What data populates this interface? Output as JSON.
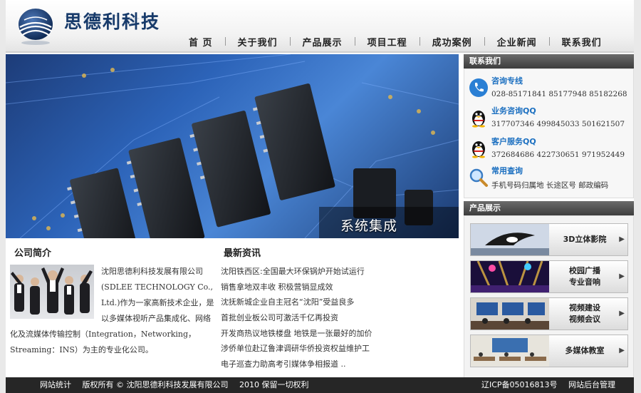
{
  "header": {
    "brand": "思德利科技",
    "nav": [
      "首 页",
      "关于我们",
      "产品展示",
      "项目工程",
      "成功案例",
      "企业新闻",
      "联系我们"
    ]
  },
  "banner": {
    "caption": "系统集成"
  },
  "intro": {
    "title": "公司简介",
    "text": "沈阳思德利科技发展有限公司(SDLEE TECHNOLOGY Co., Ltd.)作为一家高新技术企业，是以多媒体视听产品集成化、网络化及流媒体传输控制（Integration，Networking，Streaming：INS）为主的专业化公司。"
  },
  "news": {
    "title": "最新资讯",
    "items": [
      "沈阳铁西区:全国最大环保锅炉开始试运行",
      "销售拿地双丰收 积极营销显成效",
      "沈抚新城企业自主冠名“沈阳”受益良多",
      "首批创业板公司可激活千亿再投资",
      "开发商热议地铁楼盘 地铁是一张最好的加价",
      "涉侨单位赴辽鲁津调研华侨投资权益维护工",
      "电子巡查力助高考引媒体争相报道 .."
    ]
  },
  "contact": {
    "head": "联系我们",
    "items": [
      {
        "icon": "phone-icon",
        "title": "咨询专线",
        "text": "028-85171841 85177948 85182268"
      },
      {
        "icon": "qq-penguin-icon",
        "title": "业务咨询QQ",
        "text": "317707346 499845033 501621507"
      },
      {
        "icon": "qq-penguin-icon",
        "title": "客户服务QQ",
        "text": "372684686 422730651 971952449"
      },
      {
        "icon": "magnifier-icon",
        "title": "常用查询",
        "text": "手机号码归属地  长途区号  邮政编码"
      }
    ]
  },
  "products": {
    "head": "产品展示",
    "items": [
      {
        "lines": [
          "3D立体影院"
        ]
      },
      {
        "lines": [
          "校园广播",
          "专业音响"
        ]
      },
      {
        "lines": [
          "视频建设",
          "视频会议"
        ]
      },
      {
        "lines": [
          "多媒体教室"
        ]
      }
    ]
  },
  "footer": {
    "left": [
      "网站统计",
      "版权所有 © 沈阳思德利科技发展有限公司",
      "2010 保留一切权利"
    ],
    "right": [
      "辽ICP备05016813号",
      "网站后台管理"
    ]
  },
  "colors": {
    "brand": "#173a6a",
    "link": "#1b6fc0",
    "footer": "#262626",
    "sidebar_head": "#4a4a4a"
  }
}
